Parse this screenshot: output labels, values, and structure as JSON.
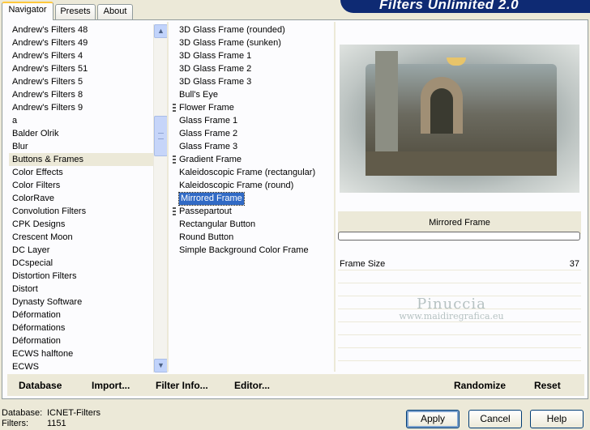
{
  "tabs": [
    {
      "label": "Navigator",
      "active": true
    },
    {
      "label": "Presets",
      "active": false
    },
    {
      "label": "About",
      "active": false
    }
  ],
  "banner": {
    "title": "Filters Unlimited 2.0"
  },
  "categories": [
    {
      "label": "Andrew's Filters 48"
    },
    {
      "label": "Andrew's Filters 49"
    },
    {
      "label": "Andrew's Filters 4"
    },
    {
      "label": "Andrew's Filters 51"
    },
    {
      "label": "Andrew's Filters 5"
    },
    {
      "label": "Andrew's Filters 8"
    },
    {
      "label": "Andrew's Filters 9"
    },
    {
      "label": "a"
    },
    {
      "label": "Balder Olrik"
    },
    {
      "label": "Blur"
    },
    {
      "label": "Buttons & Frames",
      "selected": true
    },
    {
      "label": "Color Effects"
    },
    {
      "label": "Color Filters"
    },
    {
      "label": "ColorRave"
    },
    {
      "label": "Convolution Filters"
    },
    {
      "label": "CPK Designs"
    },
    {
      "label": "Crescent Moon"
    },
    {
      "label": "DC Layer"
    },
    {
      "label": "DCspecial"
    },
    {
      "label": "Distortion Filters"
    },
    {
      "label": "Distort"
    },
    {
      "label": "Dynasty Software"
    },
    {
      "label": "Déformation"
    },
    {
      "label": "Déformations"
    },
    {
      "label": "Déformation"
    },
    {
      "label": "ECWS halftone"
    },
    {
      "label": "ECWS"
    }
  ],
  "filters": [
    {
      "label": "3D Glass Frame (rounded)"
    },
    {
      "label": "3D Glass Frame (sunken)"
    },
    {
      "label": "3D Glass Frame 1"
    },
    {
      "label": "3D Glass Frame 2"
    },
    {
      "label": "3D Glass Frame 3"
    },
    {
      "label": "Bull's Eye"
    },
    {
      "label": "Flower Frame",
      "sub": true
    },
    {
      "label": "Glass Frame 1"
    },
    {
      "label": "Glass Frame 2"
    },
    {
      "label": "Glass Frame 3"
    },
    {
      "label": "Gradient Frame",
      "sub": true
    },
    {
      "label": "Kaleidoscopic Frame (rectangular)"
    },
    {
      "label": "Kaleidoscopic Frame (round)"
    },
    {
      "label": "Mirrored Frame",
      "selected": true
    },
    {
      "label": "Passepartout",
      "sub": true
    },
    {
      "label": "Rectangular Button"
    },
    {
      "label": "Round Button"
    },
    {
      "label": "Simple Background Color Frame"
    }
  ],
  "preview": {
    "filter_name": "Mirrored Frame",
    "progress_fraction": 0
  },
  "params": [
    {
      "label": "Frame Size",
      "value": "37"
    },
    {
      "label": "",
      "value": ""
    },
    {
      "label": "",
      "value": ""
    },
    {
      "label": "",
      "value": ""
    },
    {
      "label": "",
      "value": ""
    },
    {
      "label": "",
      "value": ""
    },
    {
      "label": "",
      "value": ""
    },
    {
      "label": "",
      "value": ""
    }
  ],
  "watermark": {
    "line1": "Pinuccia",
    "line2": "www.maidiregrafica.eu"
  },
  "bottom_bar": {
    "database": "Database",
    "import": "Import...",
    "filter_info": "Filter Info...",
    "editor": "Editor...",
    "randomize": "Randomize",
    "reset": "Reset"
  },
  "footer": {
    "database_label": "Database:",
    "database_value": "ICNET-Filters",
    "filters_label": "Filters:",
    "filters_value": "1151"
  },
  "buttons": {
    "apply": "Apply",
    "cancel": "Cancel",
    "help": "Help"
  },
  "colors": {
    "selection": "#316ac5",
    "banner": "#0e2a73",
    "face": "#ece9d8"
  }
}
